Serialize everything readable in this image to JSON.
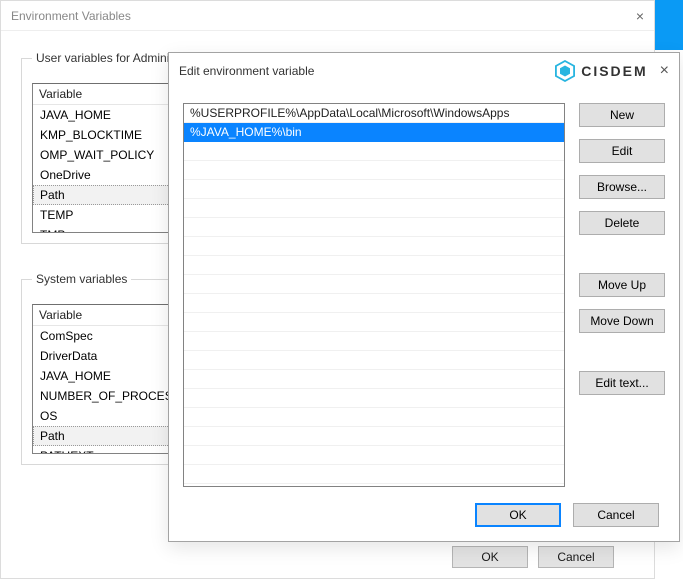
{
  "parent": {
    "title": "Environment Variables",
    "close": "×",
    "user_group": "User variables for Adminis",
    "system_group": "System variables",
    "var_header": "Variable",
    "user_vars": [
      "JAVA_HOME",
      "KMP_BLOCKTIME",
      "OMP_WAIT_POLICY",
      "OneDrive",
      "Path",
      "TEMP",
      "TMP"
    ],
    "user_selected": 4,
    "system_vars": [
      "ComSpec",
      "DriverData",
      "JAVA_HOME",
      "NUMBER_OF_PROCESS",
      "OS",
      "Path",
      "PATHEXT"
    ],
    "system_selected": 5,
    "ok": "OK",
    "cancel": "Cancel"
  },
  "dialog": {
    "title": "Edit environment variable",
    "brand": "CISDEM",
    "close": "×",
    "paths": [
      "%USERPROFILE%\\AppData\\Local\\Microsoft\\WindowsApps",
      "%JAVA_HOME%\\bin"
    ],
    "selected_index": 1,
    "buttons": {
      "new": "New",
      "edit": "Edit",
      "browse": "Browse...",
      "delete": "Delete",
      "move_up": "Move Up",
      "move_down": "Move Down",
      "edit_text": "Edit text..."
    },
    "footer": {
      "ok": "OK",
      "cancel": "Cancel"
    }
  }
}
